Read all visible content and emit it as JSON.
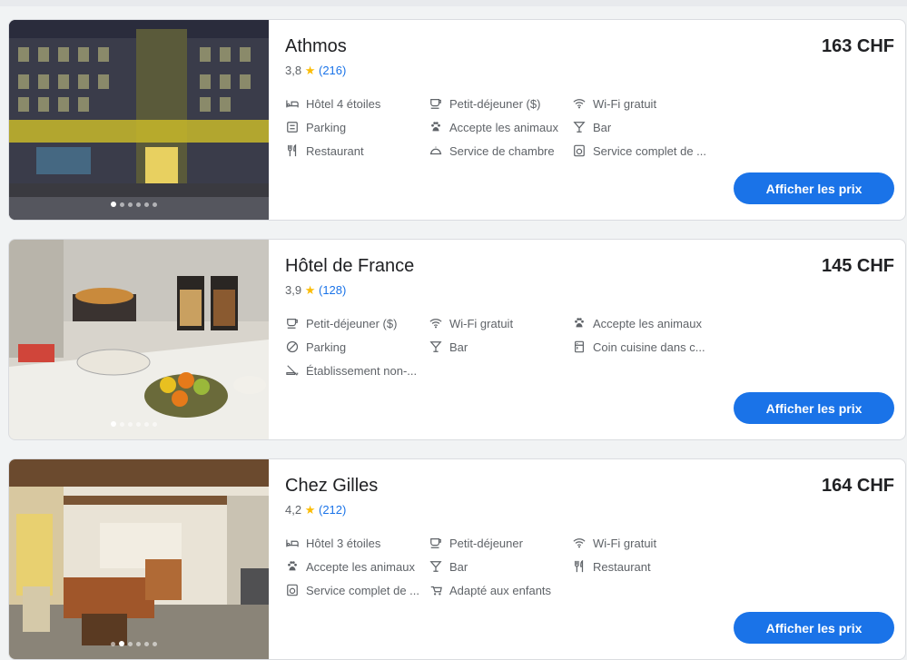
{
  "hotels": [
    {
      "name": "Athmos",
      "rating": "3,8",
      "star": "★",
      "reviews": "(216)",
      "price": "163 CHF",
      "button": "Afficher les prix",
      "amenities": [
        {
          "label": "Hôtel 4 étoiles",
          "icon": "hotel-class-icon"
        },
        {
          "label": "Petit-déjeuner ($)",
          "icon": "coffee-icon"
        },
        {
          "label": "Wi-Fi gratuit",
          "icon": "wifi-icon"
        },
        {
          "label": "Parking",
          "icon": "parking-icon"
        },
        {
          "label": "Accepte les animaux",
          "icon": "pets-icon"
        },
        {
          "label": "Bar",
          "icon": "bar-icon"
        },
        {
          "label": "Restaurant",
          "icon": "restaurant-icon"
        },
        {
          "label": "Service de chambre",
          "icon": "room-service-icon"
        },
        {
          "label": "Service complet de ...",
          "icon": "laundry-icon"
        }
      ]
    },
    {
      "name": "Hôtel de France",
      "rating": "3,9",
      "star": "★",
      "reviews": "(128)",
      "price": "145 CHF",
      "button": "Afficher les prix",
      "amenities": [
        {
          "label": "Petit-déjeuner ($)",
          "icon": "coffee-icon"
        },
        {
          "label": "Wi-Fi gratuit",
          "icon": "wifi-icon"
        },
        {
          "label": "Accepte les animaux",
          "icon": "pets-icon"
        },
        {
          "label": "Parking",
          "icon": "no-parking-icon"
        },
        {
          "label": "Bar",
          "icon": "bar-icon"
        },
        {
          "label": "Coin cuisine dans c...",
          "icon": "kitchen-icon"
        },
        {
          "label": "Établissement non-...",
          "icon": "no-smoking-icon"
        }
      ]
    },
    {
      "name": "Chez Gilles",
      "rating": "4,2",
      "star": "★",
      "reviews": "(212)",
      "price": "164 CHF",
      "button": "Afficher les prix",
      "amenities": [
        {
          "label": "Hôtel 3 étoiles",
          "icon": "hotel-class-icon"
        },
        {
          "label": "Petit-déjeuner",
          "icon": "coffee-icon"
        },
        {
          "label": "Wi-Fi gratuit",
          "icon": "wifi-icon"
        },
        {
          "label": "Accepte les animaux",
          "icon": "pets-icon"
        },
        {
          "label": "Bar",
          "icon": "bar-icon"
        },
        {
          "label": "Restaurant",
          "icon": "restaurant-icon"
        },
        {
          "label": "Service complet de ...",
          "icon": "laundry-icon"
        },
        {
          "label": "Adapté aux enfants",
          "icon": "stroller-icon"
        }
      ]
    }
  ],
  "colors": {
    "accent": "#1a73e8",
    "star": "#fbbc04",
    "muted": "#5f6368"
  }
}
